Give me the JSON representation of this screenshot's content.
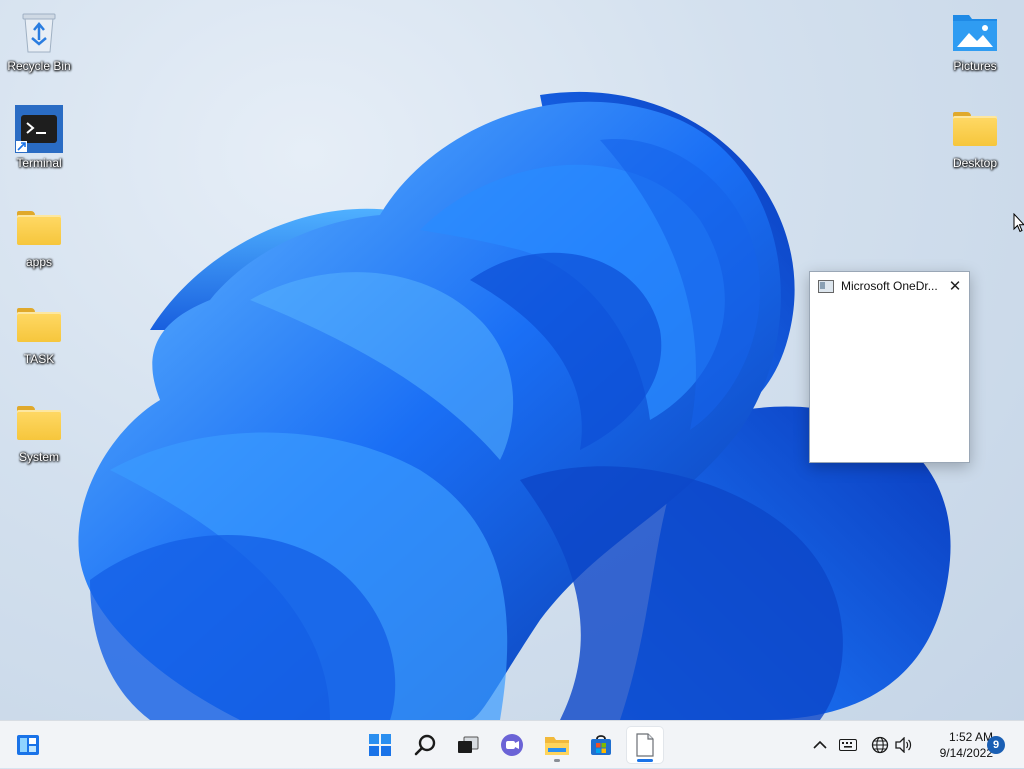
{
  "desktop": {
    "icons_left": [
      {
        "name": "recycle-bin",
        "label": "Recycle Bin",
        "icon": "recycle-bin-icon"
      },
      {
        "name": "terminal",
        "label": "Terminal",
        "icon": "terminal-icon"
      },
      {
        "name": "apps",
        "label": "apps",
        "icon": "folder-icon"
      },
      {
        "name": "task",
        "label": "TASK",
        "icon": "folder-icon"
      },
      {
        "name": "system",
        "label": "System",
        "icon": "folder-icon"
      }
    ],
    "icons_right": [
      {
        "name": "pictures",
        "label": "Pictures",
        "icon": "pictures-folder-icon"
      },
      {
        "name": "desktop",
        "label": "Desktop",
        "icon": "folder-icon"
      }
    ]
  },
  "popup": {
    "title": "Microsoft OneDr...",
    "close_glyph": "✕"
  },
  "taskbar": {
    "items": [
      {
        "name": "widgets",
        "icon": "widgets-icon"
      },
      {
        "name": "start",
        "icon": "windows-start-icon"
      },
      {
        "name": "search",
        "icon": "search-icon"
      },
      {
        "name": "task-view",
        "icon": "task-view-icon"
      },
      {
        "name": "chat",
        "icon": "chat-icon"
      },
      {
        "name": "file-explorer",
        "icon": "file-explorer-icon"
      },
      {
        "name": "store",
        "icon": "store-icon"
      },
      {
        "name": "notepad",
        "icon": "document-icon"
      }
    ],
    "tray": {
      "chevron": "^",
      "time": "1:52 AM",
      "date": "9/14/2022",
      "notification_count": "9"
    }
  },
  "colors": {
    "accent": "#1a73e8",
    "bloom_dark": "#0a3fc0",
    "bloom_light": "#3fa0ff"
  }
}
